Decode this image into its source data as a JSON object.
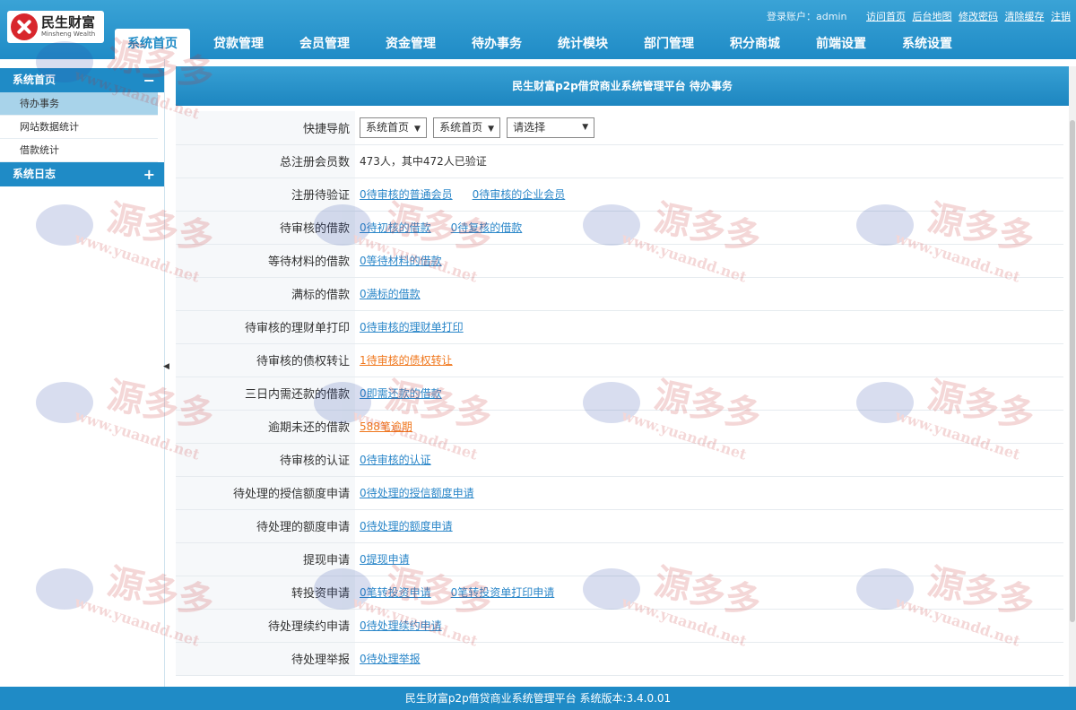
{
  "app": {
    "logo_name": "民生财富",
    "logo_en": "Minsheng Wealth",
    "brand_color": "#1f8bc6",
    "link_color": "#2b87c9",
    "warn_color": "#f0781e"
  },
  "userbar": {
    "account": "登录账户：admin",
    "links": [
      "访问首页",
      "后台地图",
      "修改密码",
      "清除缓存",
      "注销"
    ]
  },
  "nav": [
    "系统首页",
    "贷款管理",
    "会员管理",
    "资金管理",
    "待办事务",
    "统计模块",
    "部门管理",
    "积分商城",
    "前端设置",
    "系统设置"
  ],
  "sidebar": {
    "sections": [
      {
        "title": "系统首页",
        "toggle": "−",
        "items": [
          "待办事务",
          "网站数据统计",
          "借款统计"
        ]
      },
      {
        "title": "系统日志",
        "toggle": "+",
        "items": []
      }
    ],
    "collapse_glyph": "◀"
  },
  "main": {
    "title": "民生财富p2p借贷商业系统管理平台 待办事务",
    "quick_nav": {
      "label": "快捷导航",
      "selects": [
        "系统首页",
        "系统首页",
        "请选择"
      ]
    },
    "members": {
      "label": "总注册会员数",
      "value": "473人，其中472人已验证"
    },
    "rows": [
      {
        "label": "注册待验证",
        "links": [
          {
            "text": "0待审核的普通会员"
          },
          {
            "text": "0待审核的企业会员"
          }
        ]
      },
      {
        "label": "待审核的借款",
        "links": [
          {
            "text": "0待初核的借款"
          },
          {
            "text": "0待复核的借款"
          }
        ]
      },
      {
        "label": "等待材料的借款",
        "links": [
          {
            "text": "0等待材料的借款"
          }
        ]
      },
      {
        "label": "满标的借款",
        "links": [
          {
            "text": "0满标的借款"
          }
        ]
      },
      {
        "label": "待审核的理财单打印",
        "links": [
          {
            "text": "0待审核的理财单打印"
          }
        ]
      },
      {
        "label": "待审核的债权转让",
        "links": [
          {
            "text": "1待审核的债权转让",
            "warn": true
          }
        ]
      },
      {
        "label": "三日内需还款的借款",
        "links": [
          {
            "text": "0即需还款的借款"
          }
        ]
      },
      {
        "label": "逾期未还的借款",
        "links": [
          {
            "text": "588笔逾期",
            "warn": true
          }
        ]
      },
      {
        "label": "待审核的认证",
        "links": [
          {
            "text": "0待审核的认证"
          }
        ]
      },
      {
        "label": "待处理的授信额度申请",
        "links": [
          {
            "text": "0待处理的授信额度申请"
          }
        ]
      },
      {
        "label": "待处理的额度申请",
        "links": [
          {
            "text": "0待处理的额度申请"
          }
        ]
      },
      {
        "label": "提现申请",
        "links": [
          {
            "text": "0提现申请"
          }
        ]
      },
      {
        "label": "转投资申请",
        "links": [
          {
            "text": "0笔转投资申请"
          },
          {
            "text": "0笔转投资单打印申请"
          }
        ]
      },
      {
        "label": "待处理续约申请",
        "links": [
          {
            "text": "0待处理续约申请"
          }
        ]
      },
      {
        "label": "待处理举报",
        "links": [
          {
            "text": "0待处理举报"
          }
        ]
      }
    ]
  },
  "footer": "民生财富p2p借贷商业系统管理平台  系统版本:3.4.0.01",
  "watermark": {
    "text": "源多多",
    "url": "www.yuandd.net"
  }
}
